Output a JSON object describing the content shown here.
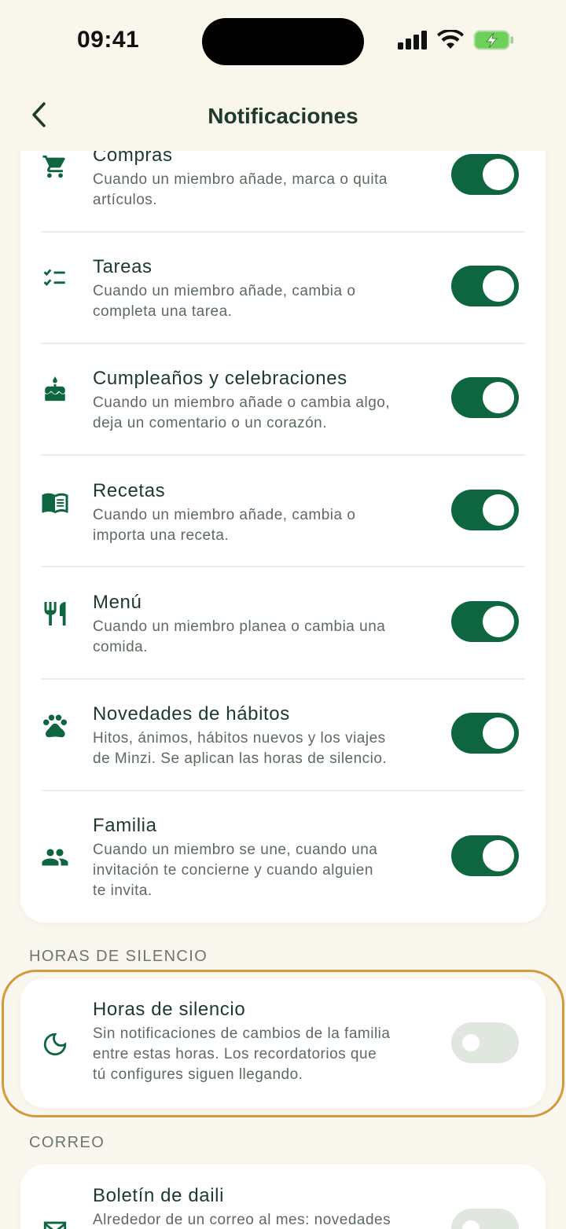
{
  "status_bar": {
    "time": "09:41"
  },
  "header": {
    "title": "Notificaciones"
  },
  "notifications": [
    {
      "id": "compras",
      "icon": "shopping-cart-icon",
      "title": "Compras",
      "desc": [
        "Cuando un miembro añade, marca o quita",
        "artículos."
      ],
      "enabled": true
    },
    {
      "id": "tareas",
      "icon": "task-list-icon",
      "title": "Tareas",
      "desc": [
        "Cuando un miembro añade, cambia o",
        "completa una tarea."
      ],
      "enabled": true
    },
    {
      "id": "cumpleanos",
      "icon": "cake-icon",
      "title": "Cumpleaños y celebraciones",
      "desc": [
        "Cuando un miembro añade o cambia algo,",
        "deja un comentario o un corazón."
      ],
      "enabled": true
    },
    {
      "id": "recetas",
      "icon": "recipe-book-icon",
      "title": "Recetas",
      "desc": [
        "Cuando un miembro añade, cambia o",
        "importa una receta."
      ],
      "enabled": true
    },
    {
      "id": "menu",
      "icon": "fork-knife-icon",
      "title": "Menú",
      "desc": [
        "Cuando un miembro planea o cambia una",
        "comida."
      ],
      "enabled": true
    },
    {
      "id": "habitos",
      "icon": "paw-icon",
      "title": "Novedades de hábitos",
      "desc": [
        "Hitos, ánimos, hábitos nuevos y los viajes",
        "de Minzi. Se aplican las horas de silencio."
      ],
      "enabled": true
    },
    {
      "id": "familia",
      "icon": "people-icon",
      "title": "Familia",
      "desc": [
        "Cuando un miembro se une, cuando una",
        "invitación te concierne y cuando alguien",
        "te invita."
      ],
      "enabled": true
    }
  ],
  "quiet_section": {
    "label": "HORAS DE SILENCIO",
    "item": {
      "icon": "moon-icon",
      "title": "Horas de silencio",
      "desc": [
        "Sin notificaciones de cambios de la familia",
        "entre estas horas. Los recordatorios que",
        "tú configures siguen llegando."
      ],
      "enabled": false
    }
  },
  "mail_section": {
    "label": "CORREO",
    "item": {
      "icon": "mail-icon",
      "title": "Boletín de daili",
      "desc": [
        "Alrededor de un correo al mes: novedades"
      ],
      "enabled": false
    }
  },
  "colors": {
    "accent": "#0e6640",
    "highlight": "#d39a3c",
    "background": "#faf7ee"
  }
}
